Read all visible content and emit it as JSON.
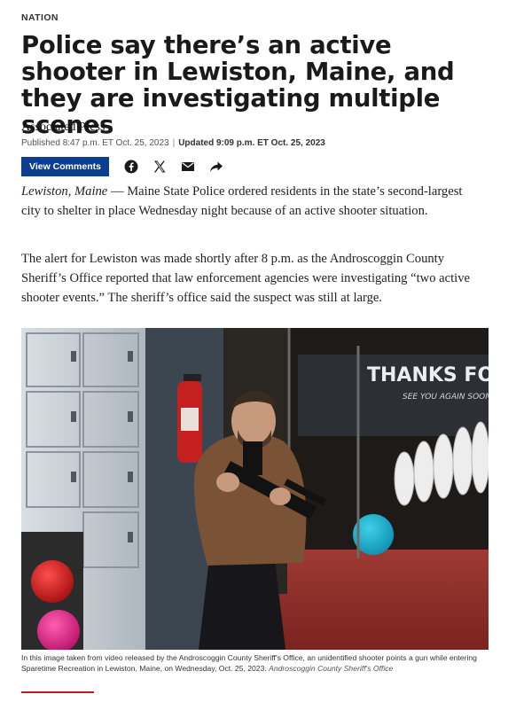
{
  "article": {
    "section": "NATION",
    "headline": "Police say there’s an active shooter in Lewiston, Maine, and they are investigating multiple scenes",
    "byline": "Associated Press",
    "published": "Published 8:47 p.m. ET Oct. 25, 2023",
    "updated": "Updated 9:09 p.m. ET Oct. 25, 2023",
    "dateline": "Lewiston, Maine",
    "para1": "— Maine State Police ordered residents in the state’s second-largest city to shelter in place Wednesday night because of an active shooter situation.",
    "para2": "The alert for Lewiston was made shortly after 8 p.m. as the Androscoggin County Sheriff’s Office reported that law enforcement agencies were investigating “two active shooter events.” The sheriff’s office said the suspect was still at large.",
    "caption": "In this image taken from video released by the Androscoggin County Sheriff's Office, an unidentified shooter points a gun while entering Sparetime Recreation in Lewiston, Maine, on Wednesday, Oct. 25, 2023.",
    "caption_credit": "Androscoggin County Sheriff's Office",
    "photo_sign_text": "THANKS FO"
  },
  "toolbar": {
    "comments_label": "View Comments",
    "share_icons": [
      "facebook-icon",
      "x-icon",
      "email-icon",
      "share-arrow-icon"
    ]
  },
  "colors": {
    "accent": "#0b3d91",
    "rule": "#c51a1a",
    "text": "#1a1a1a"
  }
}
